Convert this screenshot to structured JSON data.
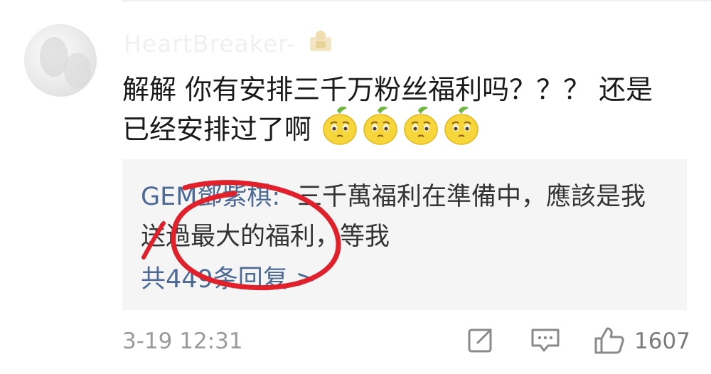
{
  "comment": {
    "username": "HeartBreaker-",
    "text_line1": "解解 你有安排三千万粉丝福利吗？？？ 还是",
    "text_line2": "已经安排过了啊",
    "emoji_icon": "lemon-face-emoji",
    "emoji_count": 4,
    "timestamp": "3-19 12:31",
    "like_count": "1607"
  },
  "reply": {
    "author": "GEM鄧紫棋:",
    "text_line1": "三千萬福利在準備中，應該是我",
    "text_line2": "送過最大的福利，等我",
    "count_label": "共449条回复 >"
  },
  "colors": {
    "link": "#4d6a94",
    "annotation": "#e0202a",
    "reply_bg": "#f5f5f5",
    "meta": "#9a9a9a"
  },
  "icons": {
    "share": "share-icon",
    "comment": "comment-icon",
    "like": "thumbs-up-icon",
    "badge": "user-badge-icon"
  }
}
